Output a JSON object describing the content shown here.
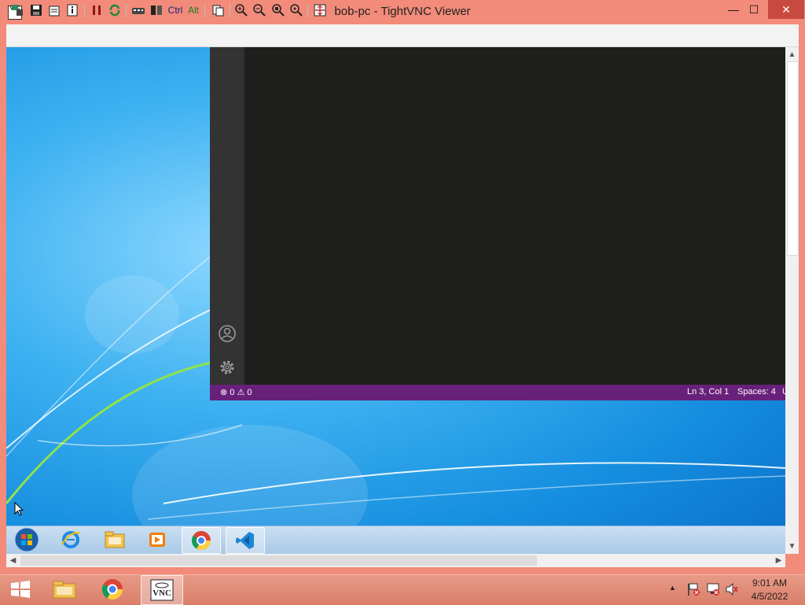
{
  "window": {
    "title": "bob-pc - TightVNC Viewer",
    "app_icon_text": "VNC",
    "minimize": "—",
    "maximize": "☐",
    "close": "✕"
  },
  "toolbar": {
    "ctrl_label": "Ctrl",
    "alt_label": "Alt"
  },
  "vscode": {
    "status": {
      "errors": "0",
      "warnings": "0",
      "position": "Ln 3, Col 1",
      "spaces": "Spaces: 4",
      "encoding_fragment": "U"
    }
  },
  "host_tray": {
    "time": "9:01 AM",
    "date": "4/5/2022",
    "chevron": "▲"
  },
  "colors": {
    "frame": "#f28b7a",
    "statusbar": "#68217a",
    "editor_bg": "#1e1f1c",
    "activity_bar": "#333333"
  }
}
